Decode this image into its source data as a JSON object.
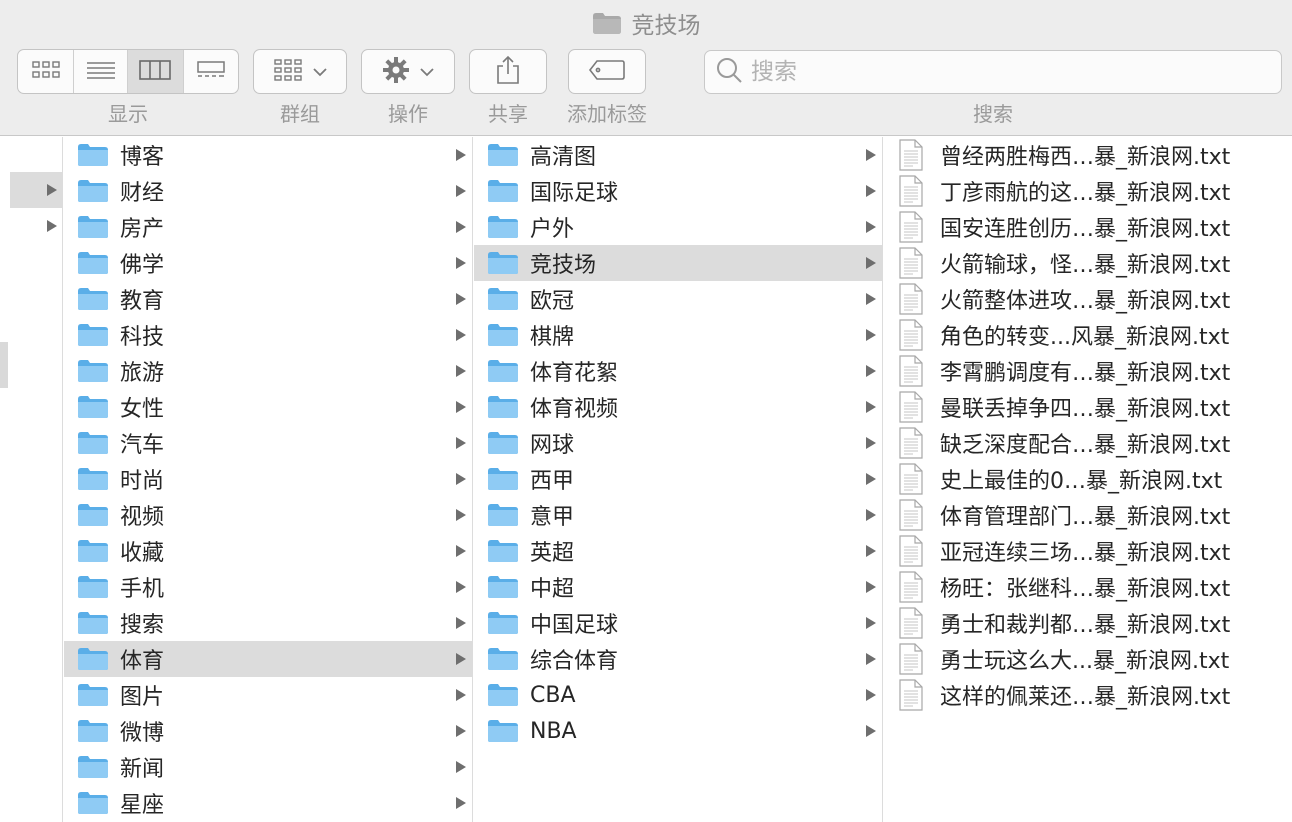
{
  "window": {
    "title": "竞技场"
  },
  "toolbar": {
    "labels": {
      "view": "显示",
      "group": "群组",
      "action": "操作",
      "share": "共享",
      "tags": "添加标签",
      "search": "搜索"
    },
    "search_placeholder": "搜索"
  },
  "column1": [
    "博客",
    "财经",
    "房产",
    "佛学",
    "教育",
    "科技",
    "旅游",
    "女性",
    "汽车",
    "时尚",
    "视频",
    "收藏",
    "手机",
    "搜索",
    "体育",
    "图片",
    "微博",
    "新闻",
    "星座"
  ],
  "column1_selected": "体育",
  "column2": [
    "高清图",
    "国际足球",
    "户外",
    "竞技场",
    "欧冠",
    "棋牌",
    "体育花絮",
    "体育视频",
    "网球",
    "西甲",
    "意甲",
    "英超",
    "中超",
    "中国足球",
    "综合体育",
    "CBA",
    "NBA"
  ],
  "column2_selected": "竞技场",
  "column3": [
    "曾经两胜梅西…暴_新浪网.txt",
    "丁彦雨航的这…暴_新浪网.txt",
    "国安连胜创历…暴_新浪网.txt",
    "火箭输球，怪…暴_新浪网.txt",
    "火箭整体进攻…暴_新浪网.txt",
    "角色的转变...风暴_新浪网.txt",
    "李霄鹏调度有…暴_新浪网.txt",
    "曼联丢掉争四…暴_新浪网.txt",
    "缺乏深度配合…暴_新浪网.txt",
    "史上最佳的0…暴_新浪网.txt",
    "体育管理部门…暴_新浪网.txt",
    "亚冠连续三场…暴_新浪网.txt",
    "杨旺：张继科…暴_新浪网.txt",
    "勇士和裁判都…暴_新浪网.txt",
    "勇士玩这么大...暴_新浪网.txt",
    "这样的佩莱还…暴_新浪网.txt"
  ],
  "colors": {
    "toolbar_bg": "#ededed",
    "selection": "#dcdcdc",
    "folder_blue": "#7fc3f2",
    "text": "#262626",
    "label_gray": "#9a9a9a"
  },
  "icons": {
    "folder": "folder-icon",
    "file": "text-file-icon",
    "view_icons": "grid-view-icon",
    "view_list": "list-view-icon",
    "view_columns": "column-view-icon",
    "view_gallery": "gallery-view-icon",
    "group": "group-icon",
    "action": "gear-icon",
    "share": "share-icon",
    "tag": "tag-icon",
    "search": "search-icon"
  }
}
